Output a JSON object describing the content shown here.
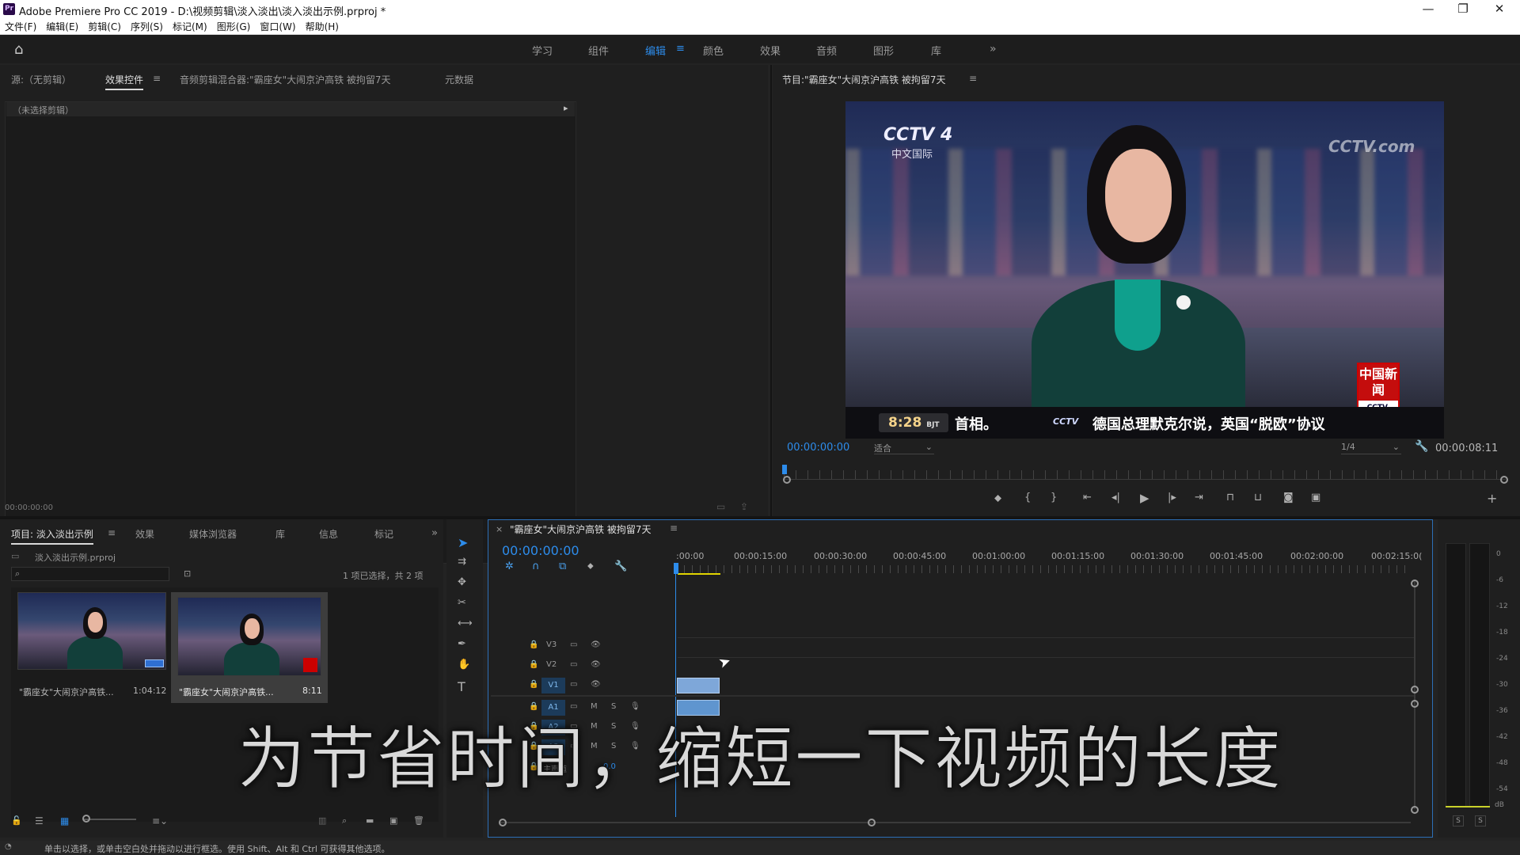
{
  "window": {
    "title": "Adobe Premiere Pro CC 2019 - D:\\视频剪辑\\淡入淡出\\淡入淡出示例.prproj *",
    "logo": "Pr"
  },
  "menu": [
    "文件(F)",
    "编辑(E)",
    "剪辑(C)",
    "序列(S)",
    "标记(M)",
    "图形(G)",
    "窗口(W)",
    "帮助(H)"
  ],
  "workspaces": {
    "items": [
      "学习",
      "组件",
      "编辑",
      "颜色",
      "效果",
      "音频",
      "图形",
      "库"
    ],
    "active": "编辑",
    "more": "»"
  },
  "source_panel": {
    "tabs": [
      "源:（无剪辑）",
      "效果控件",
      "音频剪辑混合器:\"霸座女\"大闹京沪高铁 被拘留7天",
      "元数据"
    ],
    "active_tab": "效果控件",
    "no_clip": "（未选择剪辑）",
    "timecode": "00:00:00:00"
  },
  "program_panel": {
    "title": "节目:\"霸座女\"大闹京沪高铁 被拘留7天",
    "timecode": "00:00:00:00",
    "fit": "适合",
    "resolution": "1/4",
    "duration": "00:00:08:11",
    "frame": {
      "channel": "CCTV 4",
      "channel_sub": "中文国际",
      "watermark": "CCTV.com",
      "badge": "中国新闻",
      "badge_sub": "CCTV.",
      "time": "8:28",
      "time_sub": "BJT",
      "ticker_left": "首相。",
      "ticker_logo": "CCTV",
      "ticker_text": "德国总理默克尔说，英国“脱欧”协议"
    }
  },
  "project_panel": {
    "tabs": [
      "项目: 淡入淡出示例",
      "效果",
      "媒体浏览器",
      "库",
      "信息",
      "标记"
    ],
    "active_tab": "项目: 淡入淡出示例",
    "file": "淡入淡出示例.prproj",
    "selection": "1 项已选择，共 2 项",
    "items": [
      {
        "name": "\"霸座女\"大闹京沪高铁...",
        "duration": "1:04:12"
      },
      {
        "name": "\"霸座女\"大闹京沪高铁...",
        "duration": "8:11"
      }
    ]
  },
  "timeline": {
    "tab": "\"霸座女\"大闹京沪高铁 被拘留7天",
    "timecode": "00:00:00:00",
    "ruler": [
      ":00:00",
      "00:00:15:00",
      "00:00:30:00",
      "00:00:45:00",
      "00:01:00:00",
      "00:01:15:00",
      "00:01:30:00",
      "00:01:45:00",
      "00:02:00:00",
      "00:02:15:0("
    ],
    "video_tracks": [
      "V3",
      "V2",
      "V1"
    ],
    "audio_tracks": [
      "A1",
      "A2",
      "A3"
    ],
    "master": "主声道",
    "master_value": "0.0",
    "mute": "M",
    "solo": "S"
  },
  "meter": {
    "scale": [
      "0",
      "-6",
      "-12",
      "-18",
      "-24",
      "-30",
      "-36",
      "-42",
      "-48",
      "-54",
      "dB"
    ],
    "solo": "S"
  },
  "status_bar": "单击以选择，或单击空白处并拖动以进行框选。使用 Shift、Alt 和 Ctrl 可获得其他选项。",
  "subtitle": "为节省时间，缩短一下视频的长度"
}
